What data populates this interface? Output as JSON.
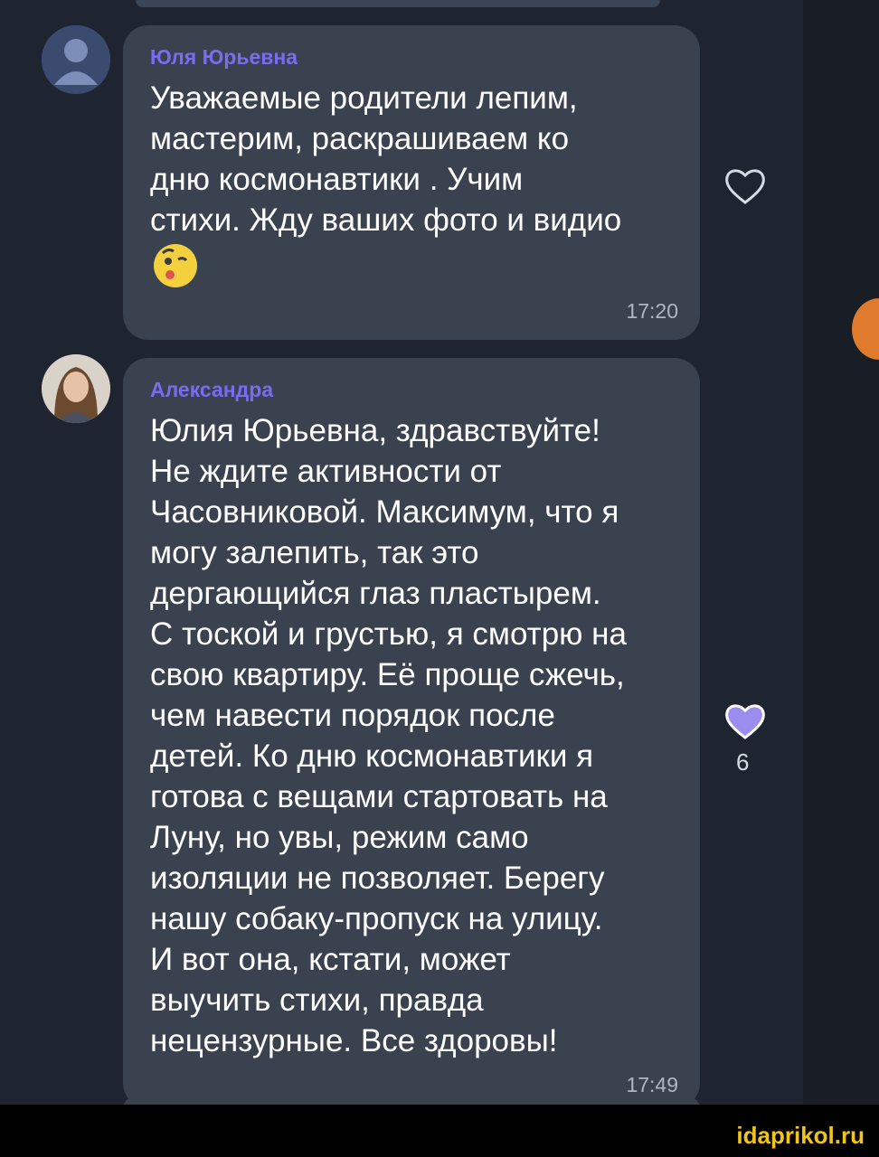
{
  "messages": [
    {
      "sender": "Юля Юрьевна",
      "text": "Уважаемые родители лепим,\nмастерим, раскрашиваем ко\nдню космонавтики . Учим\nстихи. Жду ваших фото и видио",
      "time": "17:20",
      "liked": false,
      "avatar": "default-user-avatar"
    },
    {
      "sender": "Александра",
      "text": "Юлия Юрьевна, здравствуйте!\nНе ждите активности от\nЧасовниковой. Максимум, что я\nмогу залепить, так это\nдергающийся глаз пластырем.\nС тоской и грустью, я смотрю на\nсвою квартиру. Её проще сжечь,\nчем навести порядок после\nдетей. Ко дню космонавтики я\nготова с вещами стартовать на\nЛуну, но увы, режим само\nизоляции не позволяет. Берегу\nнашу собаку-пропуск на улицу.\nИ вот она, кстати, может\nвыучить стихи, правда\nнецензурные. Все здоровы!",
      "time": "17:49",
      "liked": true,
      "like_count": "6",
      "avatar": "user-photo-avatar"
    }
  ],
  "watermark": "idaprikol.ru",
  "colors": {
    "background": "#1f2530",
    "bubble": "#3a4250",
    "sender": "#7a6cf0",
    "like_filled": "#9b8cf0",
    "watermark": "#f0c419"
  }
}
